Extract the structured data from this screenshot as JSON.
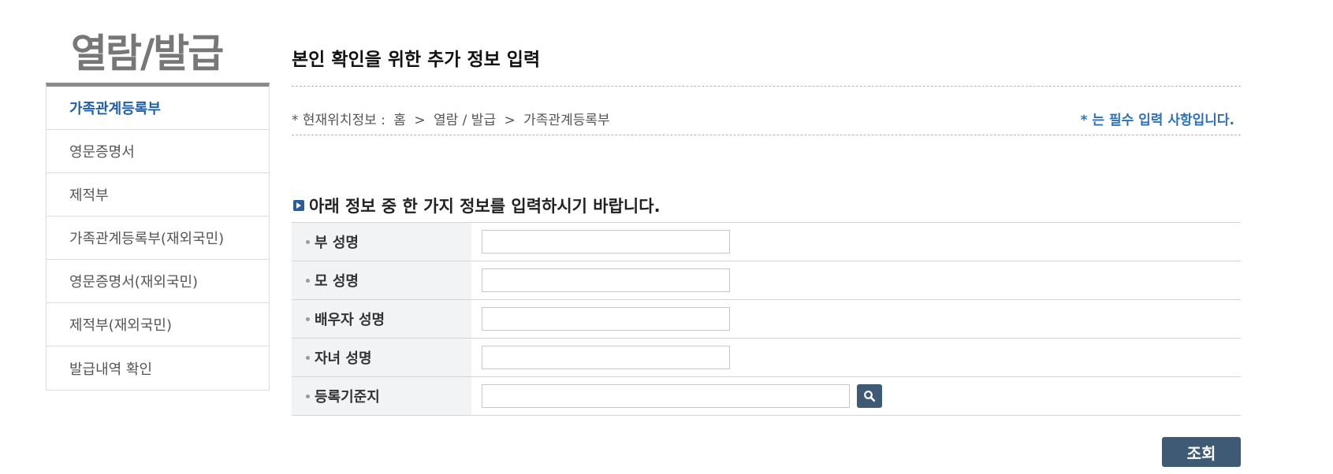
{
  "sidebar": {
    "title": "열람/발급",
    "items": [
      {
        "label": "가족관계등록부"
      },
      {
        "label": "영문증명서"
      },
      {
        "label": "제적부"
      },
      {
        "label": "가족관계등록부(재외국민)"
      },
      {
        "label": "영문증명서(재외국민)"
      },
      {
        "label": "제적부(재외국민)"
      },
      {
        "label": "발급내역 확인"
      }
    ]
  },
  "main": {
    "page_title": "본인 확인을 위한 추가 정보 입력",
    "breadcrumb": {
      "prefix": "* 현재위치정보 :",
      "path": [
        "홈",
        ">",
        "열람 / 발급",
        ">",
        "가족관계등록부"
      ]
    },
    "required_note": "* 는 필수 입력 사항입니다.",
    "section_title": "아래 정보 중 한 가지 정보를 입력하시기 바랍니다.",
    "form": {
      "fields": [
        {
          "label": "부 성명",
          "value": ""
        },
        {
          "label": "모 성명",
          "value": ""
        },
        {
          "label": "배우자 성명",
          "value": ""
        },
        {
          "label": "자녀 성명",
          "value": ""
        },
        {
          "label": "등록기준지",
          "value": ""
        }
      ]
    },
    "submit_label": "조회"
  },
  "icons": {
    "section_bullet": "arrow-square-icon",
    "search": "search-icon"
  },
  "colors": {
    "accent": "#2d72b8",
    "active_nav": "#1f5fa8",
    "button": "#3f5a75"
  }
}
